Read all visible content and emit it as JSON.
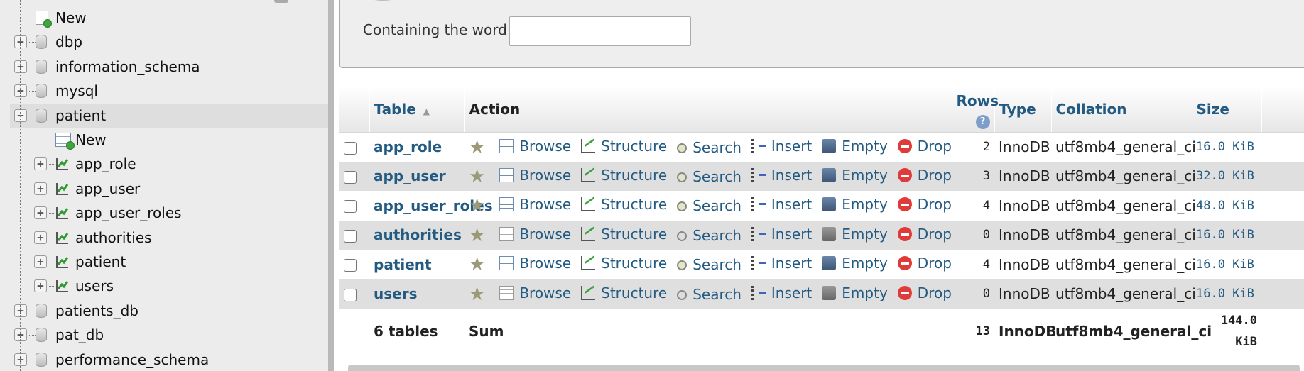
{
  "sidebar": {
    "tree": [
      {
        "label": "New",
        "kind": "new-db"
      },
      {
        "label": "dbp",
        "kind": "db"
      },
      {
        "label": "information_schema",
        "kind": "db"
      },
      {
        "label": "mysql",
        "kind": "db"
      },
      {
        "label": "patient",
        "kind": "db",
        "expanded": true,
        "highlight": true
      },
      {
        "label": "New",
        "kind": "new-table"
      },
      {
        "label": "app_role",
        "kind": "table"
      },
      {
        "label": "app_user",
        "kind": "table"
      },
      {
        "label": "app_user_roles",
        "kind": "table"
      },
      {
        "label": "authorities",
        "kind": "table"
      },
      {
        "label": "patient",
        "kind": "table"
      },
      {
        "label": "users",
        "kind": "table"
      },
      {
        "label": "patients_db",
        "kind": "db"
      },
      {
        "label": "pat_db",
        "kind": "db"
      },
      {
        "label": "performance_schema",
        "kind": "db"
      }
    ]
  },
  "search": {
    "label": "Containing the word:",
    "value": "",
    "placeholder": ""
  },
  "table": {
    "headers": {
      "table": "Table",
      "action": "Action",
      "rows": "Rows",
      "type": "Type",
      "collation": "Collation",
      "size": "Size"
    },
    "action_labels": {
      "browse": "Browse",
      "structure": "Structure",
      "search": "Search",
      "insert": "Insert",
      "empty": "Empty",
      "drop": "Drop"
    },
    "rows": [
      {
        "name": "app_role",
        "rows": "2",
        "type": "InnoDB",
        "collation": "utf8mb4_general_ci",
        "size": "16.0 KiB",
        "empty": false
      },
      {
        "name": "app_user",
        "rows": "3",
        "type": "InnoDB",
        "collation": "utf8mb4_general_ci",
        "size": "32.0 KiB",
        "empty": false
      },
      {
        "name": "app_user_roles",
        "rows": "4",
        "type": "InnoDB",
        "collation": "utf8mb4_general_ci",
        "size": "48.0 KiB",
        "empty": false
      },
      {
        "name": "authorities",
        "rows": "0",
        "type": "InnoDB",
        "collation": "utf8mb4_general_ci",
        "size": "16.0 KiB",
        "empty": true
      },
      {
        "name": "patient",
        "rows": "4",
        "type": "InnoDB",
        "collation": "utf8mb4_general_ci",
        "size": "16.0 KiB",
        "empty": false
      },
      {
        "name": "users",
        "rows": "0",
        "type": "InnoDB",
        "collation": "utf8mb4_general_ci",
        "size": "16.0 KiB",
        "empty": true
      }
    ],
    "footer": {
      "count": "6 tables",
      "sum": "Sum",
      "rows": "13",
      "type": "InnoDB",
      "collation": "utf8mb4_general_ci",
      "size_line1": "144.0",
      "size_line2": "KiB"
    }
  },
  "colors": {
    "link": "#235a81",
    "sidebar_bg": "#ececec",
    "row_alt": "#dfdfdf",
    "drop_red": "#e03b3b"
  }
}
